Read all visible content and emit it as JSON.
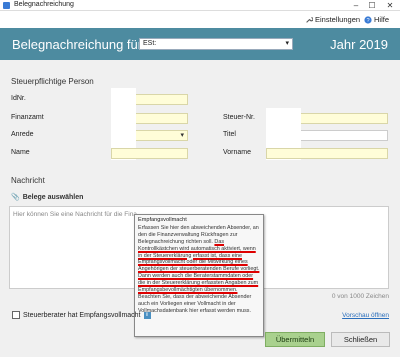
{
  "window": {
    "title": "Belegnachreichung",
    "minimize": "–",
    "maximize": "☐",
    "close": "✕"
  },
  "menu": {
    "settings_label": "Einstellungen",
    "help_label": "Hilfe"
  },
  "header": {
    "title": "Belegnachreichung für",
    "select_value": "ESt:",
    "year": "Jahr 2019"
  },
  "person": {
    "section_title": "Steuerpflichtige Person",
    "idnr_label": "IdNr.",
    "finanzamt_label": "Finanzamt",
    "steuernr_label": "Steuer-Nr.",
    "anrede_label": "Anrede",
    "titel_label": "Titel",
    "name_label": "Name",
    "vorname_label": "Vorname"
  },
  "message": {
    "section_title": "Nachricht",
    "belege_label": "Belege auswählen",
    "placeholder": "Hier können Sie eine Nachricht für die Fina",
    "char_count": "0 von 1000 Zeichen"
  },
  "tooltip": {
    "title": "Empfangsvollmacht",
    "part1": "Erfassen Sie hier den abweichenden Absender, an den die Finanzverwaltung Rückfragen zur Belegnachreichung richten soll. ",
    "part2": "Das Kontrollkästchen wird automatisch aktiviert, wenn in der Steuererklärung erfasst ist, dass eine Empfangsvollmacht oder die Mitwirkung eines Angehörigen der steuerberatenden Berufe vorliegt. Dann werden auch die Beraterstammdaten oder die in der Steuererklärung erfassten Angaben zum Empfangsbevollmächtigten übernommen.",
    "part3": " Beachten Sie, dass der abweichende Absender auch ein Vorliegen einer Vollmacht in der Vollmachsdatenbank hier erfasst werden muss."
  },
  "footer": {
    "checkbox_label": "Steuerberater hat Empfangsvollmacht",
    "info_icon": "i",
    "preview_link": "Vorschau öffnen",
    "submit_label": "Übermitteln",
    "close_label": "Schließen"
  },
  "colors": {
    "header_bg": "#4d8ba0",
    "field_bg": "#fffdd8",
    "submit_bg": "#a9d18e",
    "link": "#2a6ebb"
  },
  "icons": {
    "settings": "wrench-icon",
    "help": "help-icon",
    "attach": "paperclip-icon",
    "info": "info-icon"
  }
}
